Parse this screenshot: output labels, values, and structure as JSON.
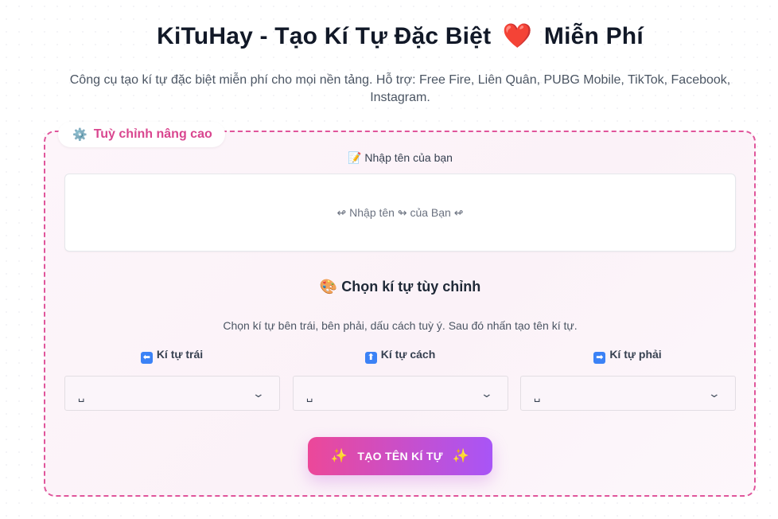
{
  "header": {
    "title_left": "KiTuHay - Tạo Kí Tự Đặc Biệt",
    "title_heart": "❤️",
    "title_right": "Miễn Phí",
    "subtitle": "Công cụ tạo kí tự đặc biệt miễn phí cho mọi nền tảng. Hỗ trợ: Free Fire, Liên Quân, PUBG Mobile, TikTok, Facebook, Instagram."
  },
  "panel": {
    "badge_icon": "⚙️",
    "badge_label": "Tuỳ chỉnh nâng cao",
    "name_label_icon": "📝",
    "name_label": "Nhập tên của bạn",
    "name_placeholder": "↫ Nhập tên ↬ của Bạn ↫",
    "name_value": "",
    "section_icon": "🎨",
    "section_title": "Chọn kí tự tùy chỉnh",
    "section_desc": "Chọn kí tự bên trái, bên phải, dấu cách tuỳ ý. Sau đó nhấn tạo tên kí tự.",
    "selects": [
      {
        "icon": "⬅",
        "label": "Kí tự trái",
        "value": "␣"
      },
      {
        "icon": "⬆",
        "label": "Kí tự cách",
        "value": "␣"
      },
      {
        "icon": "➡",
        "label": "Kí tự phải",
        "value": "␣"
      }
    ],
    "cta_label": "TẠO TÊN KÍ TỰ",
    "cta_icon": "✨"
  },
  "colors": {
    "accent_pink": "#ec4899",
    "accent_purple": "#a855f7",
    "panel_border": "#e0559b",
    "badge_text": "#d9468f"
  }
}
